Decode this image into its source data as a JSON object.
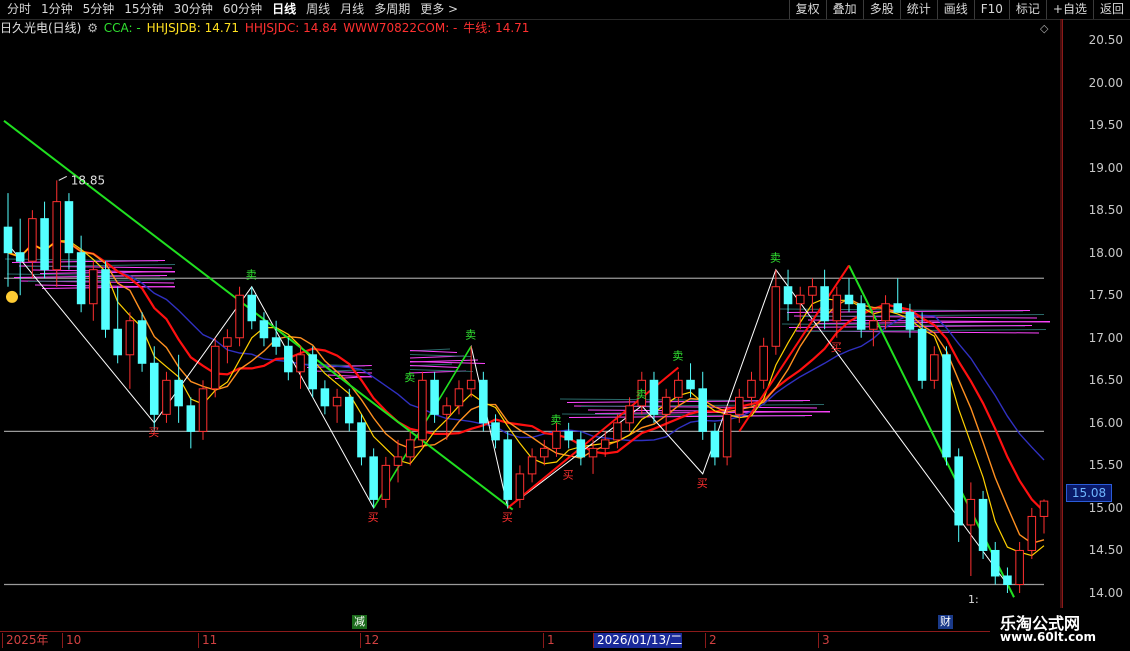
{
  "toolbar": {
    "periods": [
      "分时",
      "1分钟",
      "5分钟",
      "15分钟",
      "30分钟",
      "60分钟",
      "日线",
      "周线",
      "月线",
      "多周期",
      "更多 >"
    ],
    "active_period": "日线",
    "tools": [
      "复权",
      "叠加",
      "多股",
      "统计",
      "画线",
      "F10",
      "标记",
      "+自选",
      "返回"
    ]
  },
  "info": {
    "stock": "日久光电(日线)",
    "cca": "CCA: -",
    "hhjsjdb": "HHJSJDB: 14.71",
    "hhjsjdc": "HHJSJDC: 14.84",
    "www": "WWW70822COM: -",
    "niuxian": "牛线: 14.71"
  },
  "colors": {
    "up": "#ff3030",
    "down": "#54ffff",
    "green_line": "#20e020",
    "red_line": "#ff1010",
    "magenta": "#ff44ff",
    "yellow": "#ffd000",
    "orange": "#ff9020",
    "navy": "#3030c0"
  },
  "price_labels": [
    "20.50",
    "20.00",
    "19.50",
    "19.00",
    "18.50",
    "18.00",
    "17.50",
    "17.00",
    "16.50",
    "16.00",
    "15.50",
    "15.00",
    "14.50",
    "14.00"
  ],
  "current_price": "15.08",
  "peak_label": "18.85",
  "low_label": "1:",
  "x_labels": [
    "2025年",
    "10",
    "11",
    "12",
    "1",
    "2026/01/13/二",
    "2",
    "3"
  ],
  "selected_x": "2026/01/13/二",
  "markers": {
    "jian": "减",
    "cai": "财"
  },
  "watermark": {
    "cn": "乐淘公式网",
    "url": "www.60lt.com"
  },
  "chart_data": {
    "type": "candlestick",
    "ylim": [
      13.8,
      20.7
    ],
    "hlines": [
      17.7,
      15.9,
      14.1
    ],
    "candles": [
      [
        18.3,
        18.7,
        17.6,
        18.0
      ],
      [
        18.0,
        18.4,
        17.5,
        17.9
      ],
      [
        17.9,
        18.5,
        17.7,
        18.4
      ],
      [
        18.4,
        18.6,
        17.7,
        17.8
      ],
      [
        17.8,
        18.85,
        17.6,
        18.6
      ],
      [
        18.6,
        18.7,
        17.8,
        18.0
      ],
      [
        18.0,
        18.2,
        17.3,
        17.4
      ],
      [
        17.4,
        17.9,
        17.2,
        17.8
      ],
      [
        17.8,
        17.9,
        17.0,
        17.1
      ],
      [
        17.1,
        17.6,
        16.7,
        16.8
      ],
      [
        16.8,
        17.3,
        16.4,
        17.2
      ],
      [
        17.2,
        17.3,
        16.6,
        16.7
      ],
      [
        16.7,
        16.9,
        15.9,
        16.1
      ],
      [
        16.1,
        16.6,
        16.0,
        16.5
      ],
      [
        16.5,
        16.8,
        16.0,
        16.2
      ],
      [
        16.2,
        16.3,
        15.7,
        15.9
      ],
      [
        15.9,
        16.5,
        15.8,
        16.4
      ],
      [
        16.4,
        17.0,
        16.3,
        16.9
      ],
      [
        16.9,
        17.1,
        16.7,
        17.0
      ],
      [
        17.0,
        17.6,
        16.9,
        17.5
      ],
      [
        17.5,
        17.6,
        17.1,
        17.2
      ],
      [
        17.2,
        17.3,
        16.9,
        17.0
      ],
      [
        17.0,
        17.2,
        16.8,
        16.9
      ],
      [
        16.9,
        17.0,
        16.5,
        16.6
      ],
      [
        16.6,
        16.9,
        16.4,
        16.8
      ],
      [
        16.8,
        16.9,
        16.3,
        16.4
      ],
      [
        16.4,
        16.5,
        16.1,
        16.2
      ],
      [
        16.2,
        16.4,
        16.0,
        16.3
      ],
      [
        16.3,
        16.4,
        15.9,
        16.0
      ],
      [
        16.0,
        16.1,
        15.5,
        15.6
      ],
      [
        15.6,
        15.7,
        15.0,
        15.1
      ],
      [
        15.1,
        15.6,
        15.0,
        15.5
      ],
      [
        15.5,
        15.8,
        15.3,
        15.6
      ],
      [
        15.6,
        15.9,
        15.5,
        15.8
      ],
      [
        15.8,
        16.6,
        15.7,
        16.5
      ],
      [
        16.5,
        16.6,
        16.0,
        16.1
      ],
      [
        16.1,
        16.3,
        15.8,
        16.2
      ],
      [
        16.2,
        16.5,
        16.1,
        16.4
      ],
      [
        16.4,
        16.9,
        16.3,
        16.5
      ],
      [
        16.5,
        16.6,
        15.9,
        16.0
      ],
      [
        16.0,
        16.1,
        15.7,
        15.8
      ],
      [
        15.8,
        15.9,
        15.0,
        15.1
      ],
      [
        15.1,
        15.5,
        15.0,
        15.4
      ],
      [
        15.4,
        15.7,
        15.3,
        15.6
      ],
      [
        15.6,
        15.8,
        15.5,
        15.7
      ],
      [
        15.7,
        16.0,
        15.6,
        15.9
      ],
      [
        15.9,
        16.0,
        15.7,
        15.8
      ],
      [
        15.8,
        15.9,
        15.5,
        15.6
      ],
      [
        15.6,
        15.8,
        15.4,
        15.7
      ],
      [
        15.7,
        15.9,
        15.6,
        15.8
      ],
      [
        15.8,
        16.1,
        15.7,
        16.0
      ],
      [
        16.0,
        16.3,
        15.9,
        16.2
      ],
      [
        16.2,
        16.6,
        16.1,
        16.5
      ],
      [
        16.5,
        16.6,
        16.0,
        16.1
      ],
      [
        16.1,
        16.4,
        15.9,
        16.3
      ],
      [
        16.3,
        16.6,
        16.2,
        16.5
      ],
      [
        16.5,
        16.7,
        16.3,
        16.4
      ],
      [
        16.4,
        16.6,
        15.8,
        15.9
      ],
      [
        15.9,
        16.0,
        15.5,
        15.6
      ],
      [
        15.6,
        16.2,
        15.5,
        16.1
      ],
      [
        16.1,
        16.4,
        16.0,
        16.3
      ],
      [
        16.3,
        16.6,
        16.2,
        16.5
      ],
      [
        16.5,
        17.0,
        16.4,
        16.9
      ],
      [
        16.9,
        17.8,
        16.8,
        17.6
      ],
      [
        17.6,
        17.8,
        17.2,
        17.4
      ],
      [
        17.4,
        17.6,
        17.1,
        17.5
      ],
      [
        17.5,
        17.7,
        17.3,
        17.6
      ],
      [
        17.6,
        17.8,
        17.1,
        17.2
      ],
      [
        17.2,
        17.6,
        17.0,
        17.5
      ],
      [
        17.5,
        17.7,
        17.3,
        17.4
      ],
      [
        17.4,
        17.5,
        17.0,
        17.1
      ],
      [
        17.1,
        17.3,
        16.9,
        17.2
      ],
      [
        17.2,
        17.5,
        17.1,
        17.4
      ],
      [
        17.4,
        17.7,
        17.3,
        17.3
      ],
      [
        17.3,
        17.4,
        17.0,
        17.1
      ],
      [
        17.1,
        17.3,
        16.4,
        16.5
      ],
      [
        16.5,
        16.9,
        16.4,
        16.8
      ],
      [
        16.8,
        16.9,
        15.5,
        15.6
      ],
      [
        15.6,
        15.7,
        14.6,
        14.8
      ],
      [
        14.8,
        15.3,
        14.2,
        15.1
      ],
      [
        15.1,
        15.2,
        14.4,
        14.5
      ],
      [
        14.5,
        14.6,
        14.1,
        14.2
      ],
      [
        14.2,
        14.3,
        14.0,
        14.1
      ],
      [
        14.1,
        14.6,
        14.0,
        14.5
      ],
      [
        14.5,
        15.0,
        14.4,
        14.9
      ],
      [
        14.9,
        15.1,
        14.7,
        15.08
      ]
    ]
  }
}
